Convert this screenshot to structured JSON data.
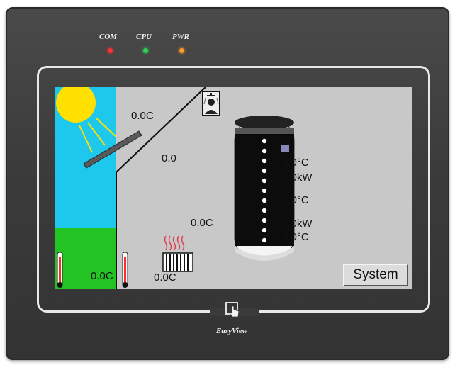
{
  "leds": [
    {
      "label": "COM",
      "color": "#ff3030"
    },
    {
      "label": "CPU",
      "color": "#30d050"
    },
    {
      "label": "PWR",
      "color": "#ff9a30"
    }
  ],
  "screen": {
    "collector_temp": "0.0C",
    "flow_value": "0.0",
    "room_temp": "0.0C",
    "outdoor_temp": "0.0C",
    "radiator_temp": "0.0C",
    "tank_top_temp": "0.0°C",
    "tank_power_1": "0.0kW",
    "tank_mid_temp": "0.0°C",
    "tank_power_2": "0.0kW",
    "tank_bottom_temp": "0.0°C",
    "system_button": "System"
  },
  "brand": "EasyView",
  "colors": {
    "sky": "#1ec8ec",
    "grass": "#22c322",
    "sun": "#ffe000",
    "screen_bg": "#c8c8c8"
  }
}
